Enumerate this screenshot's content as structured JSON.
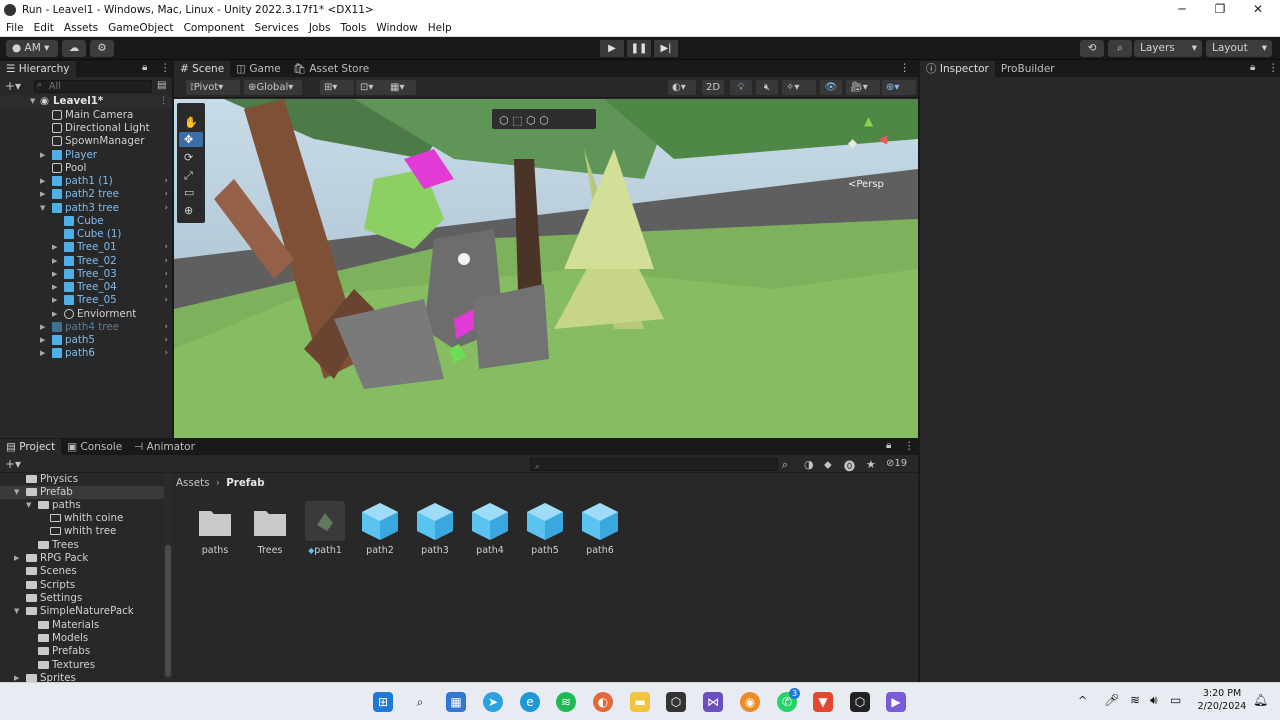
{
  "window": {
    "title": "Run - Leavel1 - Windows, Mac, Linux - Unity 2022.3.17f1* <DX11>",
    "minimize": "─",
    "maximize": "❐",
    "close": "✕"
  },
  "menu": [
    "File",
    "Edit",
    "Assets",
    "GameObject",
    "Component",
    "Services",
    "Jobs",
    "Tools",
    "Window",
    "Help"
  ],
  "toolbar": {
    "account": "AM",
    "layers": "Layers",
    "layout": "Layout"
  },
  "hierarchy": {
    "tab": "Hierarchy",
    "search_placeholder": "All",
    "scene": "Leavel1*",
    "items": [
      {
        "label": "Main Camera"
      },
      {
        "label": "Directional Light"
      },
      {
        "label": "SpownManager"
      },
      {
        "label": "Player"
      },
      {
        "label": "Pool"
      },
      {
        "label": "path1 (1)"
      },
      {
        "label": "path2 tree"
      },
      {
        "label": "path3 tree"
      },
      {
        "label": "Cube"
      },
      {
        "label": "Cube (1)"
      },
      {
        "label": "Tree_01"
      },
      {
        "label": "Tree_02"
      },
      {
        "label": "Tree_03"
      },
      {
        "label": "Tree_04"
      },
      {
        "label": "Tree_05"
      },
      {
        "label": "Enviorment"
      },
      {
        "label": "path4 tree"
      },
      {
        "label": "path5"
      },
      {
        "label": "path6"
      }
    ]
  },
  "scene": {
    "tabs": [
      "Scene",
      "Game",
      "Asset Store"
    ],
    "pivot": "Pivot",
    "global": "Global",
    "mode_2d": "2D",
    "persp": "<Persp"
  },
  "inspector": {
    "tabs": [
      "Inspector",
      "ProBuilder"
    ]
  },
  "project": {
    "tabs": [
      "Project",
      "Console",
      "Animator"
    ],
    "breadcrumb": [
      "Assets",
      "Prefab"
    ],
    "hidden_count": "19",
    "tree": [
      {
        "label": "Physics"
      },
      {
        "label": "Prefab"
      },
      {
        "label": "paths"
      },
      {
        "label": "whith coine"
      },
      {
        "label": "whith tree"
      },
      {
        "label": "Trees"
      },
      {
        "label": "RPG Pack"
      },
      {
        "label": "Scenes"
      },
      {
        "label": "Scripts"
      },
      {
        "label": "Settings"
      },
      {
        "label": "SimpleNaturePack"
      },
      {
        "label": "Materials"
      },
      {
        "label": "Models"
      },
      {
        "label": "Prefabs"
      },
      {
        "label": "Textures"
      },
      {
        "label": "Sprites"
      }
    ],
    "assets": [
      {
        "label": "paths"
      },
      {
        "label": "Trees"
      },
      {
        "label": "path1"
      },
      {
        "label": "path2"
      },
      {
        "label": "path3"
      },
      {
        "label": "path4"
      },
      {
        "label": "path5"
      },
      {
        "label": "path6"
      }
    ]
  },
  "taskbar": {
    "time": "3:20 PM",
    "date": "2/20/2024",
    "badge": "3"
  },
  "colors": {
    "accent": "#4fb0e8",
    "panel": "#282828",
    "bg": "#191919",
    "sky": "#b9cfe0",
    "ground": "#78b45a"
  }
}
